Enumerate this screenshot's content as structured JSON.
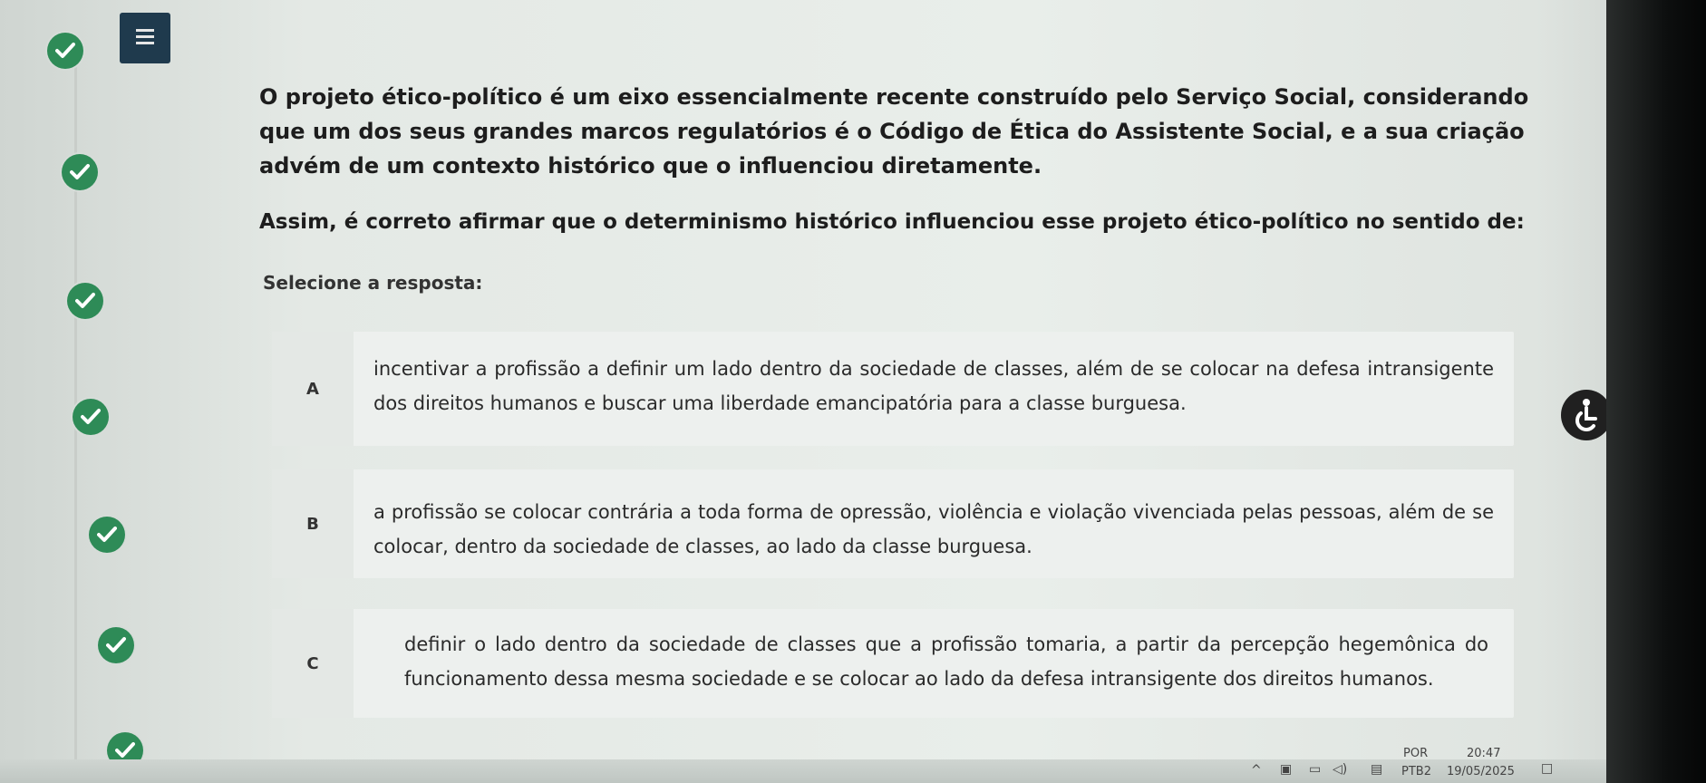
{
  "question": {
    "text": "O projeto ético-político é um eixo essencialmente recente construído pelo Serviço Social, considerando que um dos seus grandes marcos regulatórios é o Código de Ética do Assistente Social, e a sua criação advém de um contexto histórico que o influenciou diretamente.",
    "prompt": "Assim, é correto afirmar que o determinismo histórico influenciou esse projeto ético-político no sentido de:",
    "select_label": "Selecione a resposta:"
  },
  "options": [
    {
      "letter": "A",
      "text": "incentivar a profissão a definir um lado dentro da sociedade de classes, além de se colocar na defesa intransigente dos direitos humanos e buscar uma liberdade emancipatória para a classe burguesa."
    },
    {
      "letter": "B",
      "text": "a profissão se colocar contrária a toda forma de opressão, violência e violação vivenciada pelas pessoas, além de se colocar, dentro da sociedade de classes, ao lado da classe burguesa."
    },
    {
      "letter": "C",
      "text": "definir o lado dentro da sociedade de classes que a profissão tomaria, a partir da percepção hegemônica do funcionamento dessa mesma sociedade e se colocar ao lado da defesa intransigente dos direitos humanos."
    }
  ],
  "taskbar": {
    "language_top": "POR",
    "language_bottom": "PTB2",
    "time": "20:47",
    "date": "19/05/2025"
  },
  "icons": [
    "menu-icon",
    "check-icon",
    "accessibility-icon"
  ],
  "colors": {
    "check": "#2e8b57",
    "menu": "#1f3a4d"
  }
}
